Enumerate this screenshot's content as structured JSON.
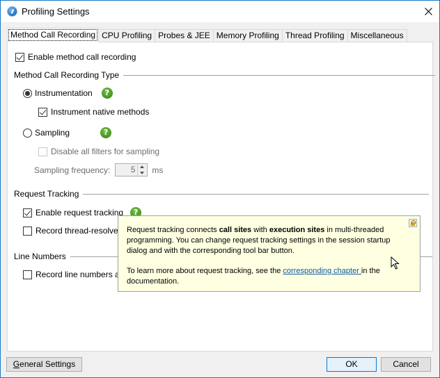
{
  "window": {
    "title": "Profiling Settings",
    "app_icon": "profiler-app-icon",
    "close_icon": "close-icon"
  },
  "tabs": [
    {
      "label": "Method Call Recording",
      "active": true
    },
    {
      "label": "CPU Profiling",
      "active": false
    },
    {
      "label": "Probes & JEE",
      "active": false
    },
    {
      "label": "Memory Profiling",
      "active": false
    },
    {
      "label": "Thread Profiling",
      "active": false
    },
    {
      "label": "Miscellaneous",
      "active": false
    }
  ],
  "method_call": {
    "enable_label": "Enable method call recording",
    "enable_checked": true,
    "type_group_title": "Method Call Recording Type",
    "instrumentation_label": "Instrumentation",
    "instrumentation_selected": true,
    "instrument_native_label": "Instrument native methods",
    "instrument_native_checked": true,
    "sampling_label": "Sampling",
    "sampling_selected": false,
    "disable_filters_label": "Disable all filters for sampling",
    "disable_filters_checked": false,
    "sampling_frequency_label": "Sampling frequency:",
    "sampling_frequency_value": "5",
    "sampling_frequency_unit": "ms"
  },
  "request_tracking": {
    "group_title": "Request Tracking",
    "enable_label": "Enable request tracking",
    "enable_checked": true,
    "record_thread_label": "Record thread-resolved c",
    "record_thread_checked": false
  },
  "line_numbers": {
    "group_title": "Line Numbers",
    "record_label": "Record line numbers and",
    "record_checked": false
  },
  "tooltip": {
    "p1_a": "Request tracking connects ",
    "p1_b": "call sites",
    "p1_c": " with ",
    "p1_d": "execution sites",
    "p1_e": " in multi-threaded programming. You can change request tracking settings in the session startup dialog and with the corresponding tool bar button.",
    "p2_a": "To learn more about request tracking, see the ",
    "p2_link": "corresponding chapter ",
    "p2_b": "in the documentation."
  },
  "footer": {
    "general_settings_mnemonic": "G",
    "general_settings_rest": "eneral Settings",
    "ok_label": "OK",
    "cancel_label": "Cancel"
  },
  "help_glyph": "?"
}
